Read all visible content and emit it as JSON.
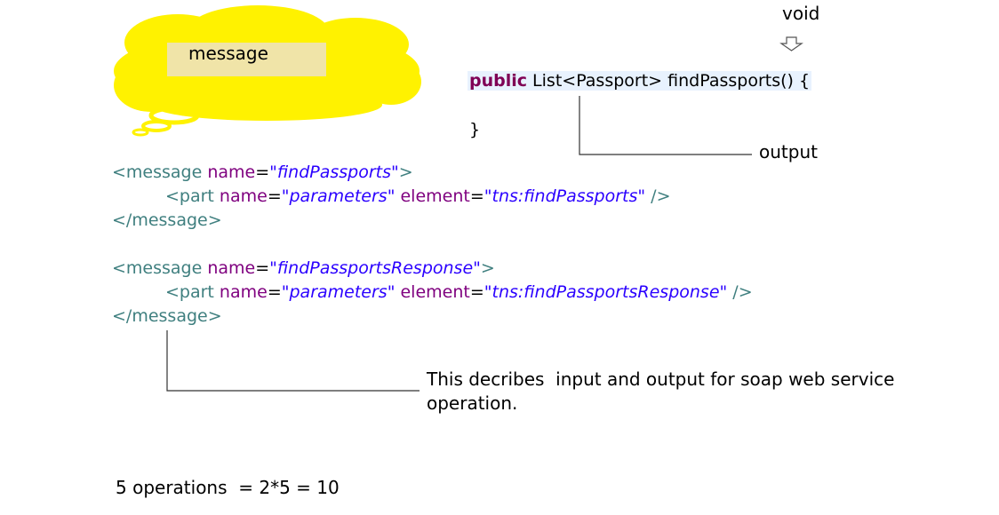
{
  "cloud": {
    "label": "message",
    "color": "#fff200",
    "label_bg": "#f0e4a8"
  },
  "void_label": "void",
  "java": {
    "keyword": "public",
    "signature_rest": " List<Passport> findPassports() {",
    "closing": "}"
  },
  "output_label": "output",
  "wsdl": {
    "msg1": {
      "open_tag": "<message",
      "name_attr": " name",
      "eq": "=",
      "name_value": "\"findPassports\"",
      "close": ">"
    },
    "part1": {
      "open_tag": "<part",
      "name_attr": " name",
      "eq": "=",
      "name_value": "\"parameters\"",
      "element_attr": " element",
      "eq2": "=",
      "element_value": "\"tns:findPassports\"",
      "close": " />"
    },
    "msg1_end": "</message>",
    "msg2": {
      "open_tag": "<message",
      "name_attr": " name",
      "eq": "=",
      "name_value": "\"findPassportsResponse\"",
      "close": ">"
    },
    "part2": {
      "open_tag": "<part",
      "name_attr": " name",
      "eq": "=",
      "name_value": "\"parameters\"",
      "element_attr": " element",
      "eq2": "=",
      "element_value": "\"tns:findPassportsResponse\"",
      "close": " />"
    },
    "msg2_end": "</message>"
  },
  "description": {
    "line1": "This decribes  input and output for soap web service",
    "line2": "operation."
  },
  "footer": "5 operations  = 2*5 = 10",
  "colors": {
    "keyword": "#7f0055",
    "tag": "#3f7f7f",
    "attribute": "#7f007f",
    "value": "#2a00ff",
    "highlight": "#e8f2fe"
  }
}
